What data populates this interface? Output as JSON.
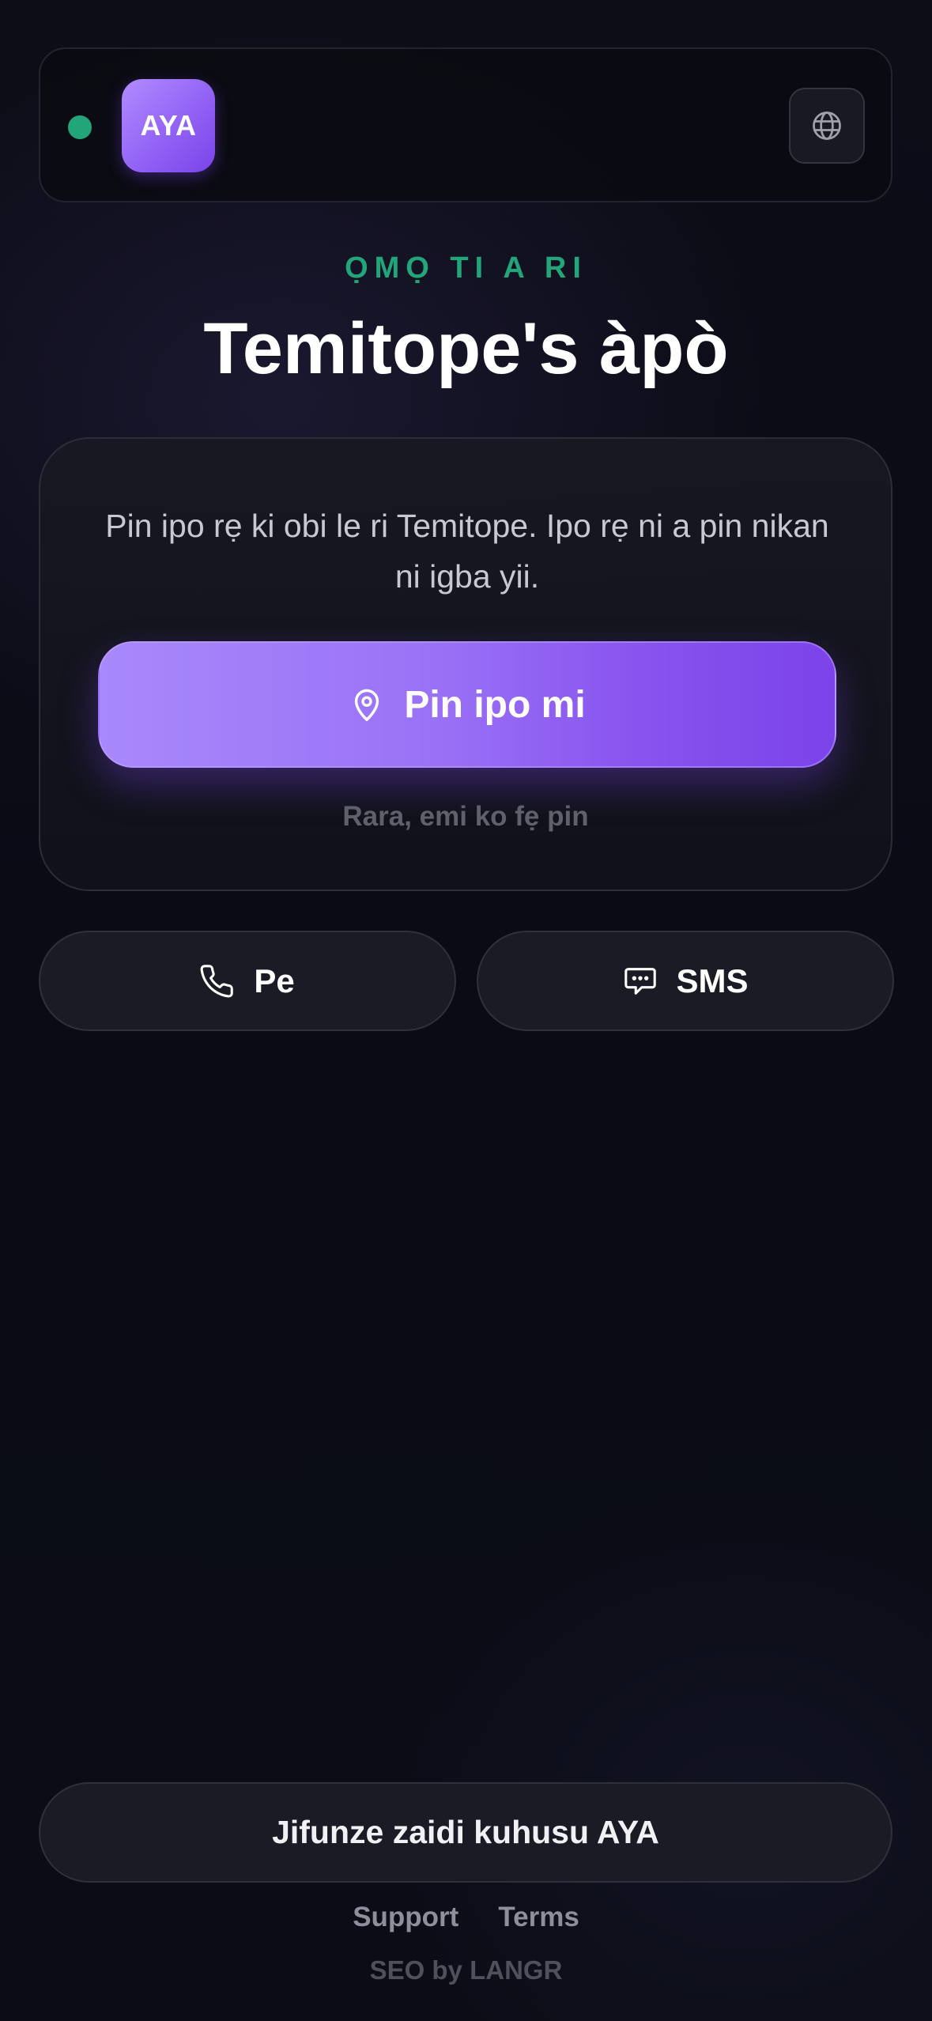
{
  "header": {
    "status_color": "#23a57a",
    "logo_text": "AYA",
    "logo_color": "#9262f5",
    "language_icon": "globe-icon"
  },
  "eyebrow": {
    "text": "ỌMỌ TI A RI",
    "color": "#23a57a"
  },
  "title": "Temitope's àpò",
  "card": {
    "description": "Pin ipo rẹ ki obi le ri Temitope. Ipo rẹ ni a pin nikan ni igba yii.",
    "pin_button": {
      "label": "Pin ipo mi",
      "icon": "location-pin-icon"
    },
    "skip_label": "Rara, emi ko fẹ pin"
  },
  "actions": {
    "call": {
      "label": "Pe",
      "icon": "phone-icon"
    },
    "sms": {
      "label": "SMS",
      "icon": "message-bubble-icon"
    }
  },
  "learn_more_label": "Jifunze zaidi kuhusu AYA",
  "footer": {
    "links": [
      "Support",
      "Terms"
    ],
    "credit": "SEO by LANGR"
  }
}
